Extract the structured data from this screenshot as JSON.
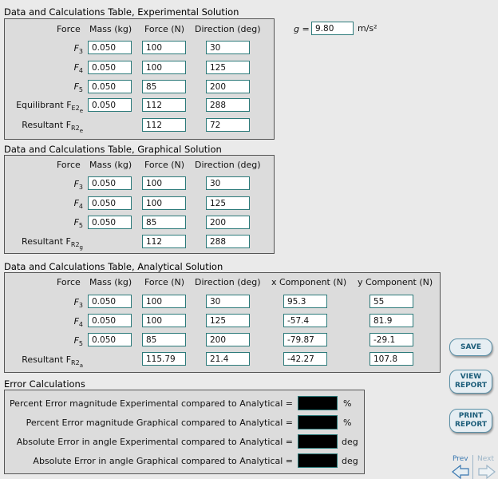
{
  "gravity": {
    "label": "g =",
    "value": "9.80",
    "unit": "m/s²"
  },
  "experimental": {
    "title": "Data and Calculations Table, Experimental Solution",
    "headers": {
      "force": "Force",
      "mass": "Mass (kg)",
      "newtons": "Force (N)",
      "direction": "Direction (deg)"
    },
    "rows": [
      {
        "label": "F",
        "sub": "3",
        "mass": "0.050",
        "force": "100",
        "dir": "30"
      },
      {
        "label": "F",
        "sub": "4",
        "mass": "0.050",
        "force": "100",
        "dir": "125"
      },
      {
        "label": "F",
        "sub": "5",
        "mass": "0.050",
        "force": "85",
        "dir": "200"
      },
      {
        "label": "Equilibrant F",
        "sub": "E2",
        "subsub": "e",
        "mass": "0.050",
        "force": "112",
        "dir": "288"
      },
      {
        "label": "Resultant F",
        "sub": "R2",
        "subsub": "e",
        "force": "112",
        "dir": "72"
      }
    ]
  },
  "graphical": {
    "title": "Data and Calculations Table, Graphical Solution",
    "headers": {
      "force": "Force",
      "mass": "Mass (kg)",
      "newtons": "Force (N)",
      "direction": "Direction (deg)"
    },
    "rows": [
      {
        "label": "F",
        "sub": "3",
        "mass": "0.050",
        "force": "100",
        "dir": "30"
      },
      {
        "label": "F",
        "sub": "4",
        "mass": "0.050",
        "force": "100",
        "dir": "125"
      },
      {
        "label": "F",
        "sub": "5",
        "mass": "0.050",
        "force": "85",
        "dir": "200"
      },
      {
        "label": "Resultant F",
        "sub": "R2",
        "subsub": "g",
        "force": "112",
        "dir": "288"
      }
    ]
  },
  "analytical": {
    "title": "Data and Calculations Table, Analytical Solution",
    "headers": {
      "force": "Force",
      "mass": "Mass (kg)",
      "newtons": "Force (N)",
      "direction": "Direction (deg)",
      "x": "x Component (N)",
      "y": "y Component (N)"
    },
    "rows": [
      {
        "label": "F",
        "sub": "3",
        "mass": "0.050",
        "force": "100",
        "dir": "30",
        "x": "95.3",
        "y": "55"
      },
      {
        "label": "F",
        "sub": "4",
        "mass": "0.050",
        "force": "100",
        "dir": "125",
        "x": "-57.4",
        "y": "81.9"
      },
      {
        "label": "F",
        "sub": "5",
        "mass": "0.050",
        "force": "85",
        "dir": "200",
        "x": "-79.87",
        "y": "-29.1"
      },
      {
        "label": "Resultant F",
        "sub": "R2",
        "subsub": "a",
        "force": "115.79",
        "dir": "21.4",
        "x": "-42.27",
        "y": "107.8"
      }
    ]
  },
  "errors": {
    "title": "Error Calculations",
    "rows": [
      {
        "label": "Percent Error magnitude Experimental compared to Analytical =",
        "unit": "%"
      },
      {
        "label": "Percent Error magnitude Graphical compared to Analytical =",
        "unit": "%"
      },
      {
        "label": "Absolute Error in angle Experimental compared to Analytical =",
        "unit": "deg"
      },
      {
        "label": "Absolute Error in angle Graphical compared to Analytical =",
        "unit": "deg"
      }
    ]
  },
  "buttons": {
    "save": "SAVE",
    "view_line1": "VIEW",
    "view_line2": "REPORT",
    "print_line1": "PRINT",
    "print_line2": "REPORT"
  },
  "nav": {
    "prev": "Prev",
    "next": "Next"
  }
}
